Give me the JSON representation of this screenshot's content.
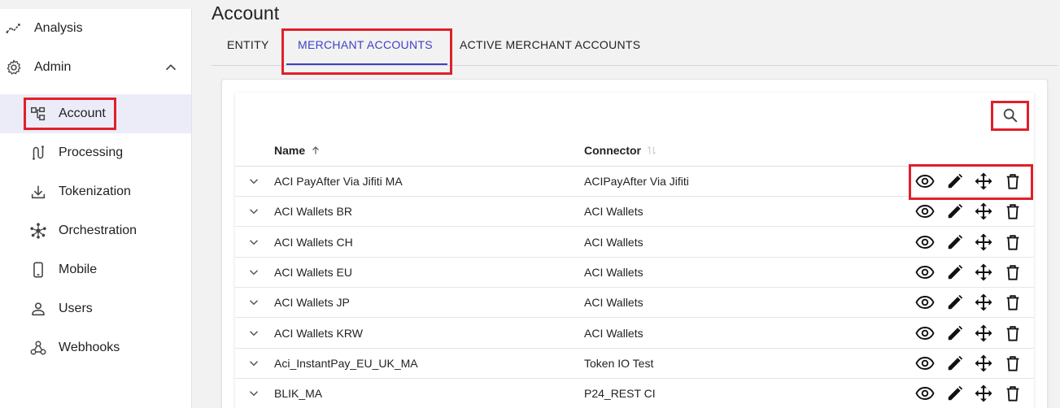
{
  "sidebar": {
    "analysis": "Analysis",
    "admin": "Admin",
    "items": [
      {
        "label": "Account",
        "icon": "account-tree-icon",
        "selected": true
      },
      {
        "label": "Processing",
        "icon": "processing-route-icon"
      },
      {
        "label": "Tokenization",
        "icon": "download-icon"
      },
      {
        "label": "Orchestration",
        "icon": "hub-icon"
      },
      {
        "label": "Mobile",
        "icon": "mobile-icon"
      },
      {
        "label": "Users",
        "icon": "user-icon"
      },
      {
        "label": "Webhooks",
        "icon": "webhook-icon"
      }
    ]
  },
  "page": {
    "title": "Account"
  },
  "tabs": [
    {
      "label": "ENTITY",
      "active": false
    },
    {
      "label": "MERCHANT ACCOUNTS",
      "active": true
    },
    {
      "label": "ACTIVE MERCHANT ACCOUNTS",
      "active": false
    }
  ],
  "table": {
    "columns": {
      "name": "Name",
      "connector": "Connector"
    },
    "sort": {
      "column": "name",
      "direction": "ascending"
    },
    "rows": [
      {
        "name": "ACI PayAfter Via Jifiti MA",
        "connector": "ACIPayAfter Via Jifiti"
      },
      {
        "name": "ACI Wallets BR",
        "connector": "ACI Wallets"
      },
      {
        "name": "ACI Wallets CH",
        "connector": "ACI Wallets"
      },
      {
        "name": "ACI Wallets EU",
        "connector": "ACI Wallets"
      },
      {
        "name": "ACI Wallets JP",
        "connector": "ACI Wallets"
      },
      {
        "name": "ACI Wallets KRW",
        "connector": "ACI Wallets"
      },
      {
        "name": "Aci_InstantPay_EU_UK_MA",
        "connector": "Token IO Test"
      },
      {
        "name": "BLIK_MA",
        "connector": "P24_REST CI"
      }
    ],
    "row_actions": [
      "eye-icon",
      "edit-pencil-icon",
      "move-arrows-icon",
      "trash-icon"
    ]
  },
  "colors": {
    "accent": "#3f3fc9",
    "highlight": "#e0202a",
    "selected_bg": "#ececf9"
  }
}
